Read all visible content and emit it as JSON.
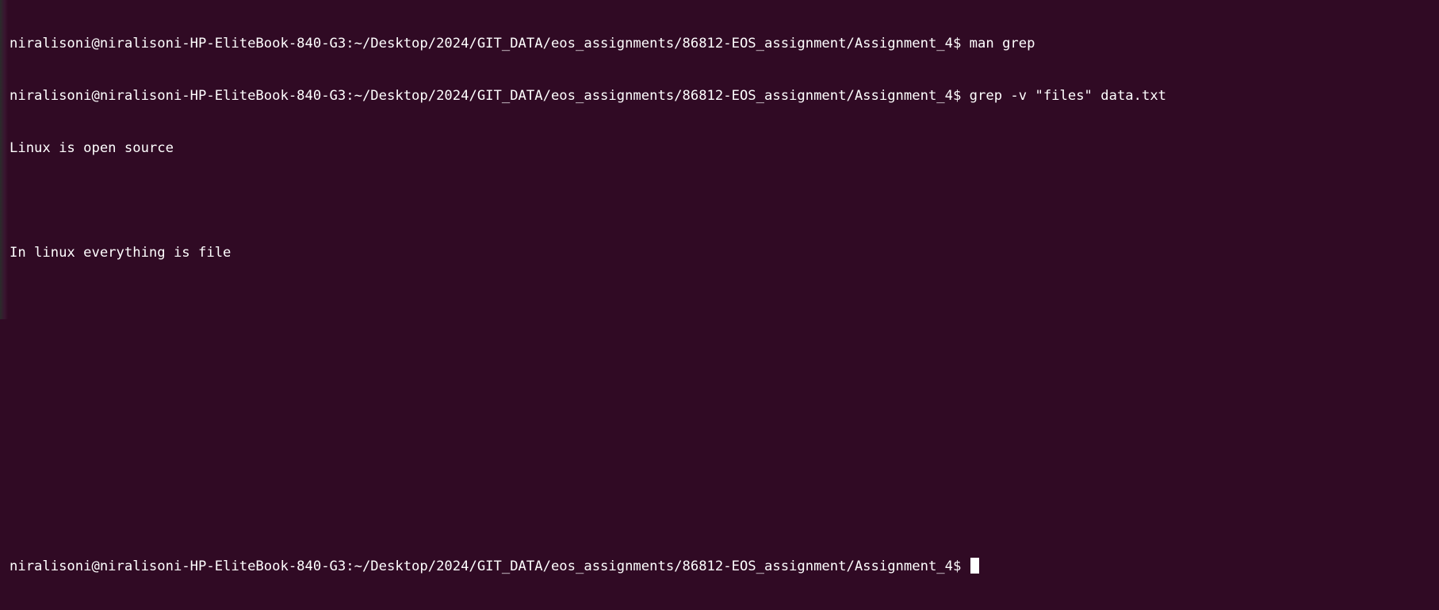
{
  "terminal": {
    "colors": {
      "background": "#300a24",
      "text": "#ffffff"
    },
    "lines": [
      "niralisoni@niralisoni-HP-EliteBook-840-G3:~/Desktop/2024/GIT_DATA/eos_assignments/86812-EOS_assignment/Assignment_4$ man grep",
      "niralisoni@niralisoni-HP-EliteBook-840-G3:~/Desktop/2024/GIT_DATA/eos_assignments/86812-EOS_assignment/Assignment_4$ grep -v \"files\" data.txt",
      "Linux is open source",
      "",
      "In linux everything is file",
      "",
      "",
      "",
      "",
      ""
    ],
    "prompt": "niralisoni@niralisoni-HP-EliteBook-840-G3:~/Desktop/2024/GIT_DATA/eos_assignments/86812-EOS_assignment/Assignment_4$ ",
    "input": ""
  }
}
